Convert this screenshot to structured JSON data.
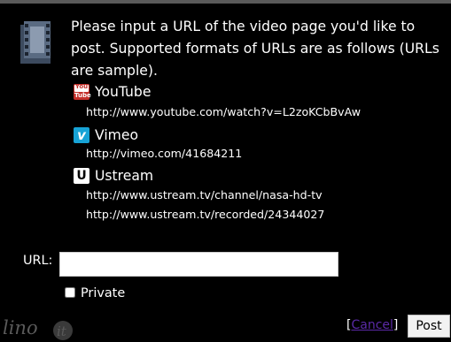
{
  "intro_text": "Please input a URL of the video page you'd like to post. Supported formats of URLs are as follows (URLs are sample).",
  "services": [
    {
      "name": "YouTube",
      "icon": "youtube-logo-icon",
      "urls": [
        "http://www.youtube.com/watch?v=L2zoKCbBvAw"
      ]
    },
    {
      "name": "Vimeo",
      "icon": "vimeo-logo-icon",
      "urls": [
        "http://vimeo.com/41684211"
      ]
    },
    {
      "name": "Ustream",
      "icon": "ustream-logo-icon",
      "urls": [
        "http://www.ustream.tv/channel/nasa-hd-tv",
        "http://www.ustream.tv/recorded/24344027"
      ]
    }
  ],
  "youtube_logo_text": {
    "top": "You",
    "bottom": "Tube"
  },
  "vimeo_logo_letter": "v",
  "ustream_logo_letter": "U",
  "form": {
    "url_label": "URL:",
    "url_value": "",
    "private_label": "Private",
    "private_checked": false
  },
  "footer": {
    "logo_text": "lino",
    "logo_badge": "it",
    "cancel_label": "Cancel",
    "bracket_open": "[",
    "bracket_close": "]",
    "post_label": "Post"
  },
  "colors": {
    "background": "#000000",
    "youtube": "#c4302b",
    "vimeo": "#17a3d6",
    "cancel_link": "#5b2aa8"
  }
}
